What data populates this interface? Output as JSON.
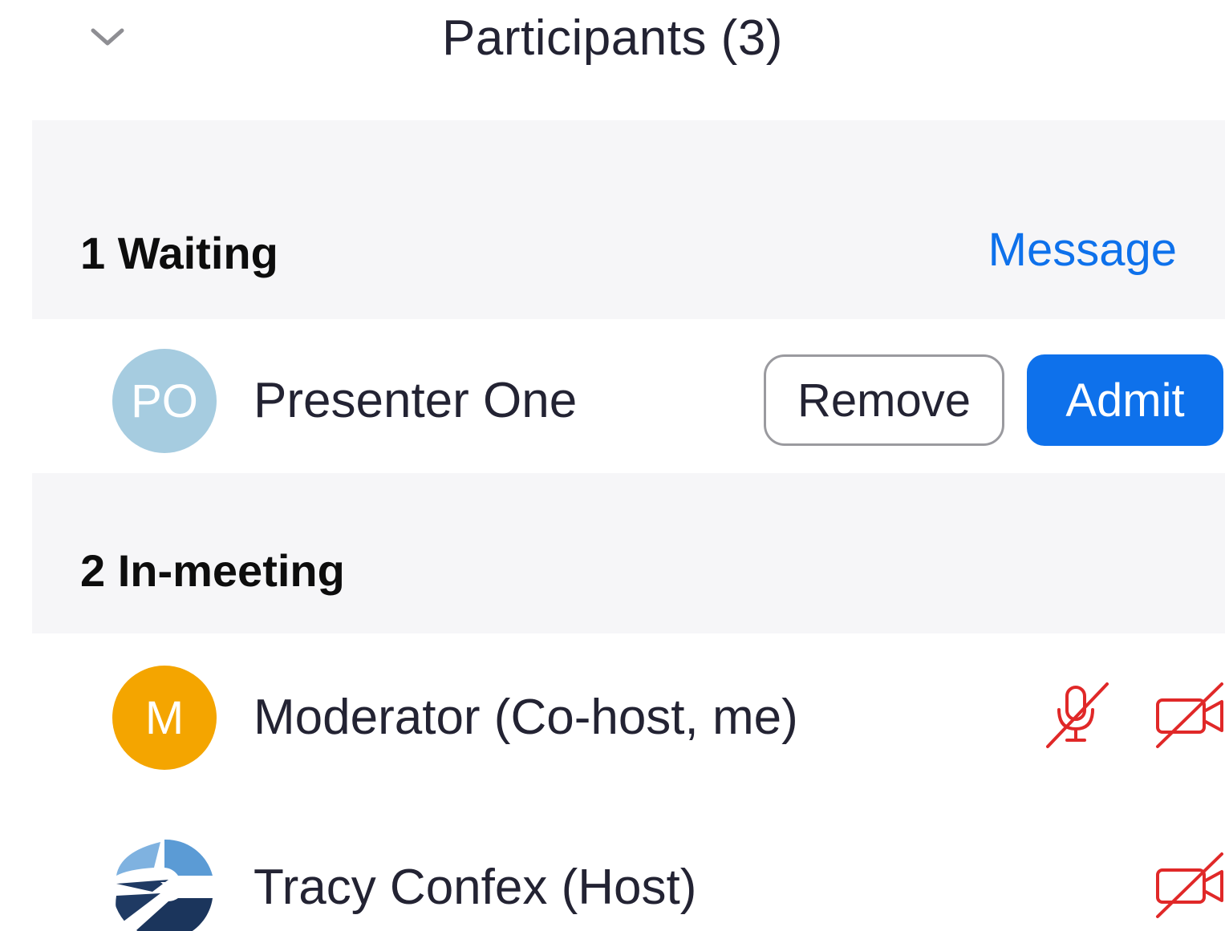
{
  "header": {
    "title": "Participants (3)",
    "collapse_icon": "chevron-down-icon"
  },
  "waiting": {
    "label": "1 Waiting",
    "message_link": "Message",
    "participants": [
      {
        "name": "Presenter One",
        "initials": "PO",
        "avatar_color": "#a6cce0",
        "remove_label": "Remove",
        "admit_label": "Admit"
      }
    ]
  },
  "in_meeting": {
    "label": "2 In-meeting",
    "participants": [
      {
        "name": "Moderator (Co-host, me)",
        "initials": "M",
        "avatar_color": "#f4a500",
        "mic": "muted-mic-icon",
        "video": "video-off-icon"
      },
      {
        "name": "Tracy Confex (Host)",
        "avatar": "confex-logo",
        "video": "video-off-icon"
      }
    ]
  },
  "colors": {
    "accent": "#0e71eb",
    "muted_red": "#e02828",
    "section_bg": "#f6f6f8"
  }
}
